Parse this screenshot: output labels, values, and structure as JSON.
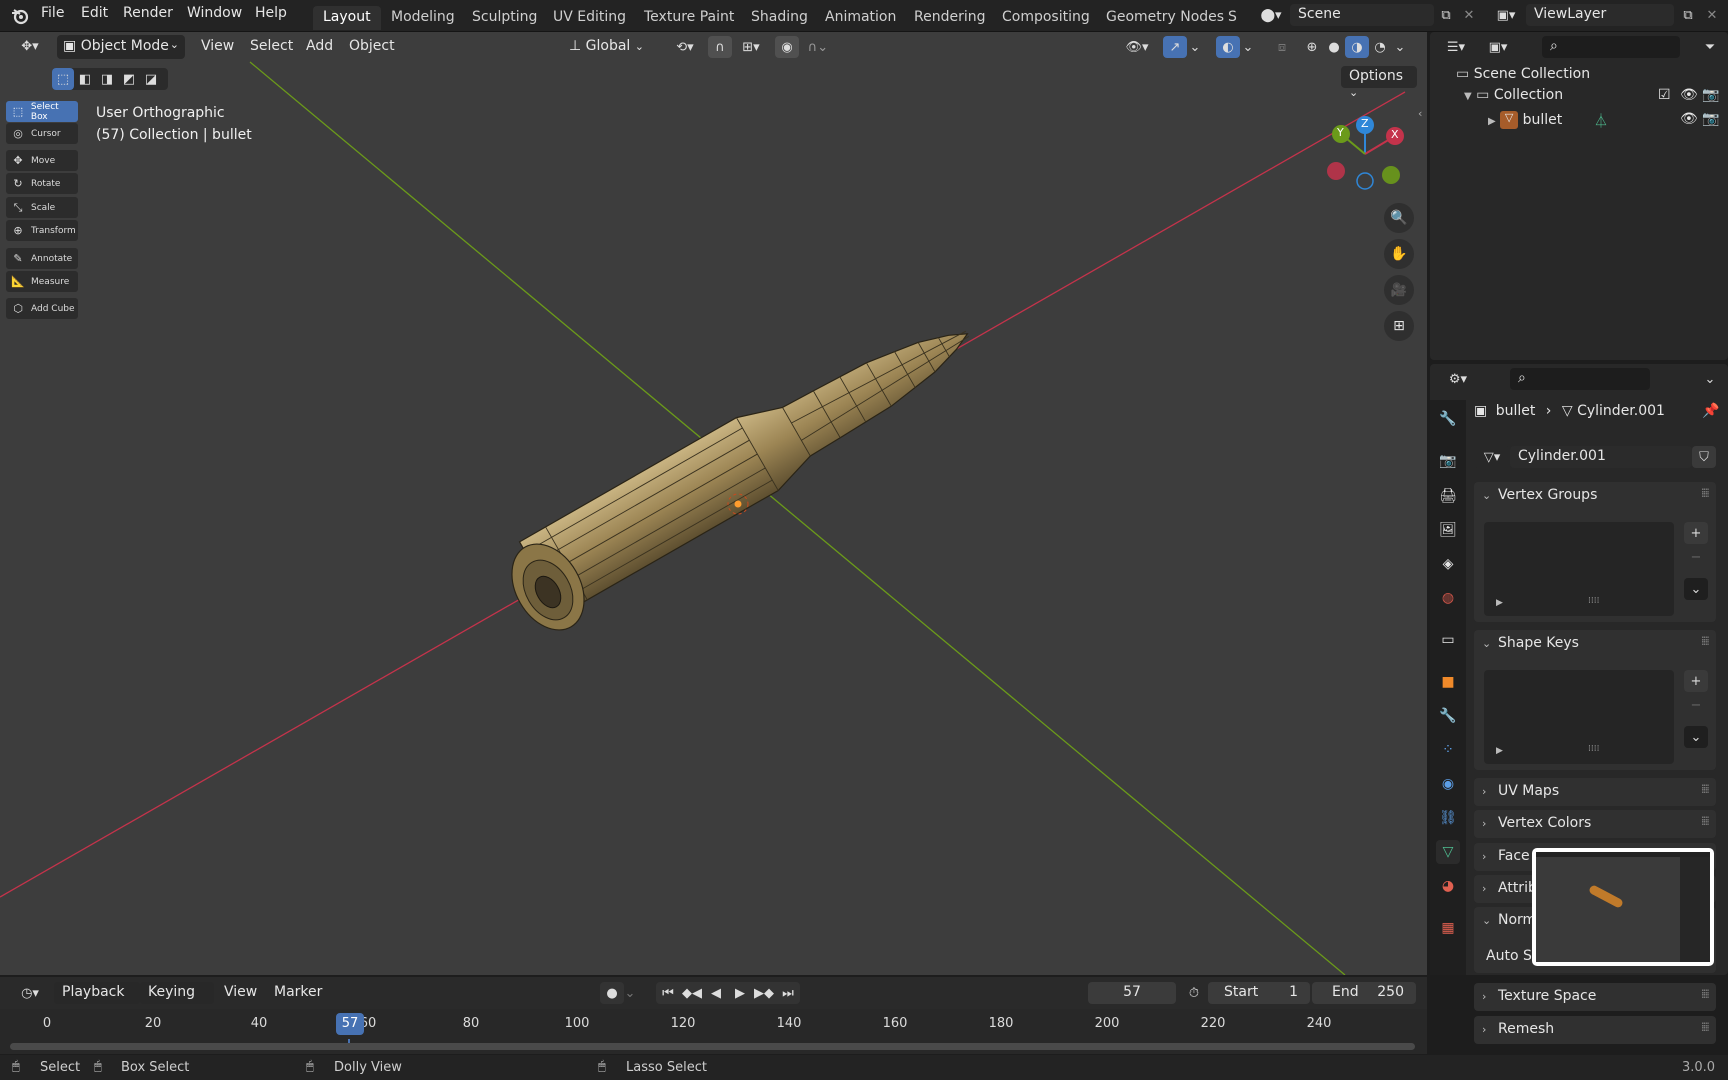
{
  "menu": {
    "file": "File",
    "edit": "Edit",
    "render": "Render",
    "window": "Window",
    "help": "Help"
  },
  "workspaces": [
    "Layout",
    "Modeling",
    "Sculpting",
    "UV Editing",
    "Texture Paint",
    "Shading",
    "Animation",
    "Rendering",
    "Compositing",
    "Geometry Nodes",
    "S"
  ],
  "scene": {
    "name": "Scene"
  },
  "viewlayer": {
    "name": "ViewLayer"
  },
  "viewport_header": {
    "mode": "Object Mode",
    "view": "View",
    "select": "Select",
    "add": "Add",
    "object": "Object",
    "orientation": "Global",
    "options": "Options"
  },
  "tools": [
    "Select Box",
    "Cursor",
    "Move",
    "Rotate",
    "Scale",
    "Transform",
    "Annotate",
    "Measure",
    "Add Cube"
  ],
  "overlay": {
    "view_name": "User Orthographic",
    "context": "(57) Collection | bullet"
  },
  "gizmo": {
    "x": "X",
    "y": "Y",
    "z": "Z"
  },
  "outliner": {
    "scene_collection": "Scene Collection",
    "collection": "Collection",
    "object": "bullet"
  },
  "properties": {
    "breadcrumb_object": "bullet",
    "breadcrumb_data": "Cylinder.001",
    "mesh_name": "Cylinder.001",
    "panels": {
      "vertex_groups": "Vertex Groups",
      "shape_keys": "Shape Keys",
      "uv_maps": "UV Maps",
      "vertex_colors": "Vertex Colors",
      "face_maps": "Face",
      "attributes": "Attrib",
      "normals": "Norm",
      "auto_smooth": "Auto S",
      "texture_space": "Texture Space",
      "remesh": "Remesh"
    }
  },
  "timeline": {
    "playback": "Playback",
    "keying": "Keying",
    "view": "View",
    "marker": "Marker",
    "current_frame": "57",
    "start_label": "Start",
    "start": "1",
    "end_label": "End",
    "end": "250",
    "ticks": [
      "0",
      "20",
      "40",
      "60",
      "80",
      "100",
      "120",
      "140",
      "160",
      "180",
      "200",
      "220",
      "240"
    ],
    "playhead": "57"
  },
  "statusbar": {
    "select": "Select",
    "box_select": "Box Select",
    "dolly_view": "Dolly View",
    "lasso_select": "Lasso Select",
    "version": "3.0.0"
  },
  "colors": {
    "accent": "#4772b3",
    "x_axis": "#c4334b",
    "y_axis": "#6b9a1a",
    "z_axis": "#2f87d8",
    "bullet_body": "#a08a5c"
  }
}
